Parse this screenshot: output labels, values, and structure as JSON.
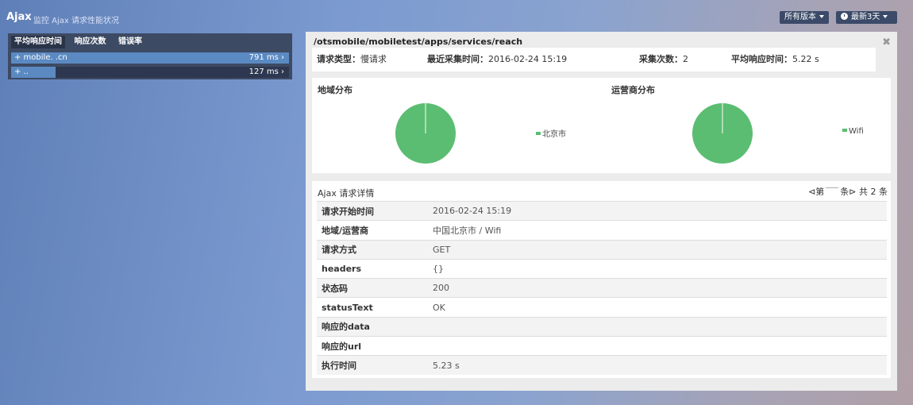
{
  "header": {
    "title": "Ajax",
    "subtitle": "监控 Ajax 请求性能状况",
    "version_btn": "所有版本",
    "range_btn": "最新3天"
  },
  "left_panel": {
    "tabs": [
      "平均响应时间",
      "响应次数",
      "错误率"
    ],
    "active_tab": 0,
    "rows": [
      {
        "name": "+ mobile.          .cn",
        "value": "791 ms ›",
        "fill": 1.0
      },
      {
        "name": "+ ..",
        "value": "127 ms ›",
        "fill": 0.16
      }
    ]
  },
  "right_panel": {
    "path": "/otsmobile/mobiletest/apps/services/reach",
    "close": "✖",
    "summary": {
      "type_label": "请求类型：",
      "type_value": "慢请求",
      "last_label": "最近采集时间：",
      "last_value": "2016-02-24 15:19",
      "count_label": "采集次数：",
      "count_value": "2",
      "avg_label": "平均响应时间：",
      "avg_value": "5.22 s"
    },
    "geo": {
      "title": "地域分布",
      "legend": "北京市",
      "share": 1.0
    },
    "isp": {
      "title": "运营商分布",
      "legend": "Wifi",
      "share": 1.0
    },
    "details": {
      "title": "Ajax 请求详情",
      "pager_prev": "⊲第",
      "pager_next": "条⊳",
      "pager_total": "共 2 条",
      "rows": [
        {
          "key": "请求开始时间",
          "value": "2016-02-24 15:19"
        },
        {
          "key": "地域/运营商",
          "value": "中国北京市 / Wifi"
        },
        {
          "key": "请求方式",
          "value": "GET"
        },
        {
          "key": "headers",
          "value": "{}"
        },
        {
          "key": "状态码",
          "value": "200"
        },
        {
          "key": "statusText",
          "value": "OK"
        },
        {
          "key": "响应的data",
          "value": ""
        },
        {
          "key": "响应的url",
          "value": ""
        },
        {
          "key": "执行时间",
          "value": "5.23 s"
        }
      ]
    },
    "colors": {
      "pie": "#5bbd72",
      "bar": "#5b8ac2"
    }
  }
}
